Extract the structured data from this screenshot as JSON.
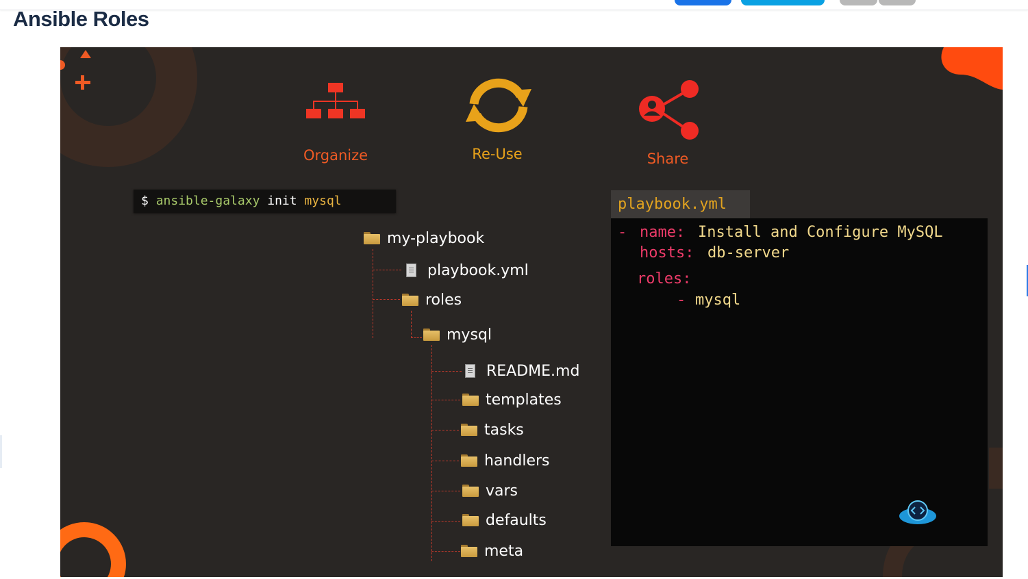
{
  "page": {
    "title": "Ansible Roles"
  },
  "colors": {
    "accent": "#ef5a24",
    "yaml_key": "#ed3b69",
    "yaml_value": "#f2d98c",
    "slide_bg": "#292624",
    "title": "#1b2c45"
  },
  "features": [
    {
      "label": "Organize",
      "icon": "org-chart-icon"
    },
    {
      "label": "Re-Use",
      "icon": "recycle-icon"
    },
    {
      "label": "Share",
      "icon": "share-icon"
    }
  ],
  "terminal": {
    "prompt": "$",
    "command": "ansible-galaxy",
    "subcommand": "init",
    "argument": "mysql"
  },
  "tree": {
    "root": "my-playbook",
    "playbook_file": "playbook.yml",
    "roles": "roles",
    "mysql": "mysql",
    "mysql_children": [
      "README.md",
      "templates",
      "tasks",
      "handlers",
      "vars",
      "defaults",
      "meta"
    ]
  },
  "playbook": {
    "filename": "playbook.yml",
    "dash": "-",
    "name_key": "name:",
    "name_value": "Install and Configure MySQL",
    "hosts_key": "hosts:",
    "hosts_value": "db-server",
    "roles_key": "roles:",
    "role_dash": "-",
    "role_value": "mysql"
  }
}
